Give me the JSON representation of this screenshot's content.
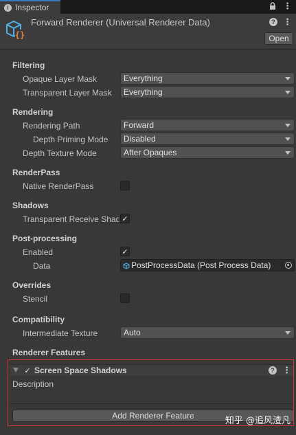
{
  "tab": {
    "label": "Inspector"
  },
  "header": {
    "title": "Forward Renderer (Universal Renderer Data)",
    "open_label": "Open"
  },
  "filtering": {
    "heading": "Filtering",
    "opaque_label": "Opaque Layer Mask",
    "opaque_value": "Everything",
    "transparent_label": "Transparent Layer Mask",
    "transparent_value": "Everything"
  },
  "rendering": {
    "heading": "Rendering",
    "path_label": "Rendering Path",
    "path_value": "Forward",
    "depth_priming_label": "Depth Priming Mode",
    "depth_priming_value": "Disabled",
    "depth_texture_label": "Depth Texture Mode",
    "depth_texture_value": "After Opaques"
  },
  "renderpass": {
    "heading": "RenderPass",
    "native_label": "Native RenderPass",
    "native_checked": false
  },
  "shadows": {
    "heading": "Shadows",
    "transparent_receive_label": "Transparent Receive Shadows",
    "transparent_receive_checked": true
  },
  "postprocessing": {
    "heading": "Post-processing",
    "enabled_label": "Enabled",
    "enabled_checked": true,
    "data_label": "Data",
    "data_value": "PostProcessData (Post Process Data)"
  },
  "overrides": {
    "heading": "Overrides",
    "stencil_label": "Stencil",
    "stencil_checked": false
  },
  "compatibility": {
    "heading": "Compatibility",
    "intermediate_label": "Intermediate Texture",
    "intermediate_value": "Auto"
  },
  "renderer_features": {
    "heading": "Renderer Features",
    "feature_title": "Screen Space Shadows",
    "feature_enabled": true,
    "description_label": "Description",
    "add_button": "Add Renderer Feature"
  },
  "watermark": "知乎 @追风渣凡",
  "colors": {
    "highlight_border": "#d83232",
    "tab_accent": "#3a79bb"
  }
}
